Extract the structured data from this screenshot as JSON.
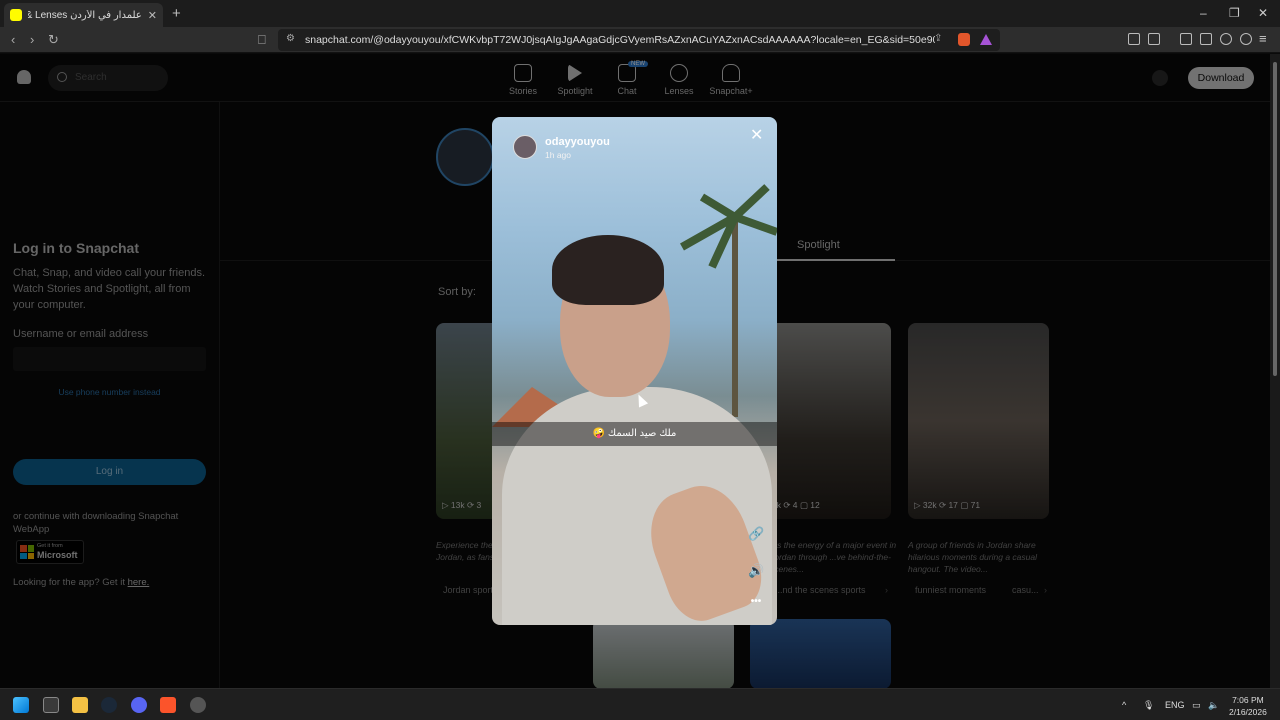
{
  "browser": {
    "tab_title": "علمدار في الأردن Spotlight & Lenses",
    "tab_close": "✕",
    "new_tab": "+",
    "url": "snapchat.com/@odayyouyou/xfCWKvbpT72WJ0jsqAIgJgAAgaGdjcGVyemRsAZxnACuYAZxnACsdAAAAAA?locale=en_EG&sid=50e903965f9b49779d4...",
    "win_minimize": "–",
    "win_restore": "❐",
    "win_close": "✕"
  },
  "nav": {
    "search_placeholder": "Search",
    "items": [
      {
        "label": "Stories"
      },
      {
        "label": "Spotlight"
      },
      {
        "label": "Chat",
        "badge": "NEW"
      },
      {
        "label": "Lenses"
      },
      {
        "label": "Snapchat+"
      }
    ],
    "download": "Download"
  },
  "sidebar": {
    "title": "Log in to Snapchat",
    "description": "Chat, Snap, and video call your friends. Watch Stories and Spotlight, all from your computer.",
    "username_label": "Username or email address",
    "phone_link": "Use phone number instead",
    "login_button": "Log in",
    "continue_text": "or continue with downloading Snapchat WebApp",
    "ms_small": "Get it from",
    "ms_name": "Microsoft",
    "app_text": "Looking for the app? Get it",
    "app_link": "here."
  },
  "profile": {
    "spotlight_tab": "Spotlight",
    "sort_by": "Sort by:"
  },
  "cards": [
    {
      "stats": "▷ 13k ⟳ 3",
      "desc": "Experience the Kings League in Jordan, as fans...",
      "chip": "Jordan sports"
    },
    {
      "stats": "▷ 9.8k ⟳ 4 ▢ 12",
      "desc": "...s the energy of a major event in Jordan through ...ve behind-the-scenes...",
      "chip": "...nd the scenes sports"
    },
    {
      "stats": "▷ 32k ⟳ 17 ▢ 71",
      "desc": "A group of friends in Jordan share hilarious moments during a casual hangout. The video...",
      "chip": "funniest moments",
      "chip2": "casu..."
    }
  ],
  "modal": {
    "username": "odayyouyou",
    "time": "1h ago",
    "caption": "ملك صيد السمك 🤪",
    "close": "✕",
    "link_icon": "🔗",
    "sound_icon": "🔊",
    "more_icon": "•••"
  },
  "taskbar": {
    "lang": "ENG",
    "time": "7:06 PM",
    "date": "2/16/2026",
    "chevron": "^"
  }
}
